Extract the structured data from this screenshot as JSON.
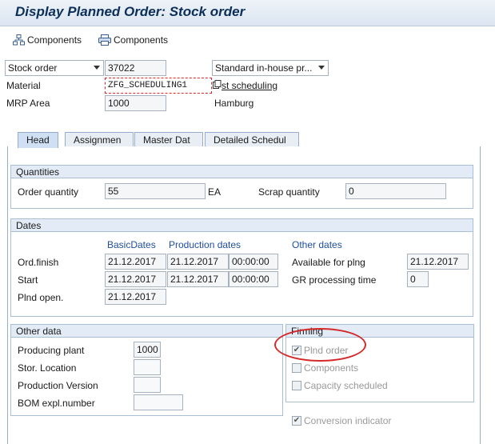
{
  "window": {
    "title": "Display Planned Order: Stock order"
  },
  "toolbar": {
    "components_1": "Components",
    "components_2": "Components",
    "icon_1": "hierarchy-icon",
    "icon_2": "printer-icon"
  },
  "header": {
    "order_type": "Stock order",
    "order_number": "37022",
    "procurement": "Standard in-house pr...",
    "material_label": "Material",
    "material_value": "ZFG_SCHEDULING1",
    "material_text": "st scheduling",
    "mrp_area_label": "MRP Area",
    "mrp_area_value": "1000",
    "mrp_area_text": "Hamburg"
  },
  "tabs": [
    {
      "label": "Head"
    },
    {
      "label": "Assignmen"
    },
    {
      "label": "Master Dat"
    },
    {
      "label": "Detailed Schedul"
    }
  ],
  "quantities": {
    "heading": "Quantities",
    "order_qty_label": "Order quantity",
    "order_qty_value": "55",
    "unit": "EA",
    "scrap_label": "Scrap quantity",
    "scrap_value": "0"
  },
  "dates": {
    "heading": "Dates",
    "col_basic": "BasicDates",
    "col_production": "Production dates",
    "col_other": "Other dates",
    "ord_finish_label": "Ord.finish",
    "ord_finish_basic": "21.12.2017",
    "ord_finish_prod": "21.12.2017",
    "ord_finish_time": "00:00:00",
    "start_label": "Start",
    "start_basic": "21.12.2017",
    "start_prod": "21.12.2017",
    "start_time": "00:00:00",
    "plnd_open_label": "Plnd open.",
    "plnd_open_basic": "21.12.2017",
    "available_label": "Available for plng",
    "available_value": "21.12.2017",
    "gr_label": "GR processing time",
    "gr_value": "0"
  },
  "other_data": {
    "heading": "Other data",
    "plant_label": "Producing plant",
    "plant_value": "1000",
    "stor_label": "Stor. Location",
    "stor_value": "",
    "prod_version_label": "Production Version",
    "prod_version_value": "",
    "bom_label": "BOM expl.number",
    "bom_value": ""
  },
  "firming": {
    "heading": "Firming",
    "plnd_order": "Plnd order",
    "components": "Components",
    "capacity": "Capacity scheduled",
    "conversion": "Conversion indicator",
    "plnd_order_checked": true,
    "components_checked": false,
    "capacity_checked": false,
    "conversion_checked": true
  },
  "colors": {
    "annotation": "#d42a2a",
    "accent": "#1e4d9e"
  }
}
